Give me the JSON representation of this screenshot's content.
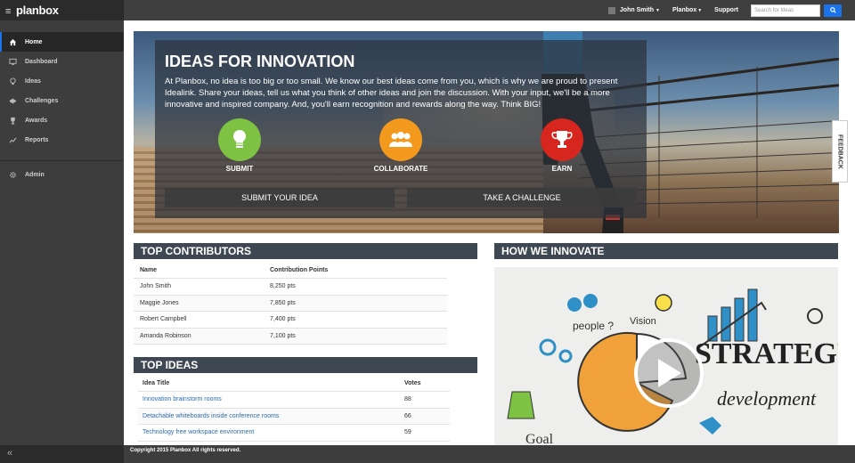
{
  "brand": {
    "logo_text": "planbox",
    "accent": "#1a73e8"
  },
  "topbar": {
    "user_name": "John Smith",
    "planbox_menu": "Planbox",
    "support_label": "Support",
    "search_placeholder": "Search for Ideas"
  },
  "sidebar": {
    "items": [
      {
        "label": "Home",
        "icon": "home-icon",
        "active": true
      },
      {
        "label": "Dashboard",
        "icon": "monitor-icon"
      },
      {
        "label": "Ideas",
        "icon": "lightbulb-icon"
      },
      {
        "label": "Challenges",
        "icon": "megaphone-icon"
      },
      {
        "label": "Awards",
        "icon": "trophy-icon"
      },
      {
        "label": "Reports",
        "icon": "chart-icon"
      }
    ],
    "admin_label": "Admin",
    "collapse_label": "«"
  },
  "hero": {
    "title": "IDEAS FOR INNOVATION",
    "text": "At Planbox, no idea is too big or too small. We know our best ideas come from you, which is why we are proud to present Idealink. Share your ideas, tell us what you think of other ideas and join the discussion. With your input, we'll be a more innovative and inspired company. And, you'll earn recognition and rewards along the way. Think BIG!",
    "actions": [
      {
        "label": "SUBMIT",
        "color": "#7dc242"
      },
      {
        "label": "COLLABORATE",
        "color": "#f39a1e"
      },
      {
        "label": "EARN",
        "color": "#d7261e"
      }
    ],
    "cta_submit": "SUBMIT YOUR IDEA",
    "cta_challenge": "TAKE A CHALLENGE",
    "feedback_label": "FEEDBACK"
  },
  "contributors": {
    "title": "TOP CONTRIBUTORS",
    "columns": [
      "Name",
      "Contribution Points"
    ],
    "rows": [
      [
        "John Smith",
        "8,250 pts"
      ],
      [
        "Maggie Jones",
        "7,850 pts"
      ],
      [
        "Robert Campbell",
        "7,400 pts"
      ],
      [
        "Amanda Robinson",
        "7,100 pts"
      ]
    ]
  },
  "ideas": {
    "title": "TOP IDEAS",
    "columns": [
      "Idea Title",
      "Votes"
    ],
    "rows": [
      [
        "Innovation brainstorm rooms",
        "88"
      ],
      [
        "Detachable whiteboards inside conference rooms",
        "66"
      ],
      [
        "Technology free workspace environment",
        "59"
      ]
    ]
  },
  "innovate": {
    "title": "HOW WE INNOVATE"
  },
  "footer": {
    "text": "Copyright 2015 Planbox All rights reserved."
  }
}
